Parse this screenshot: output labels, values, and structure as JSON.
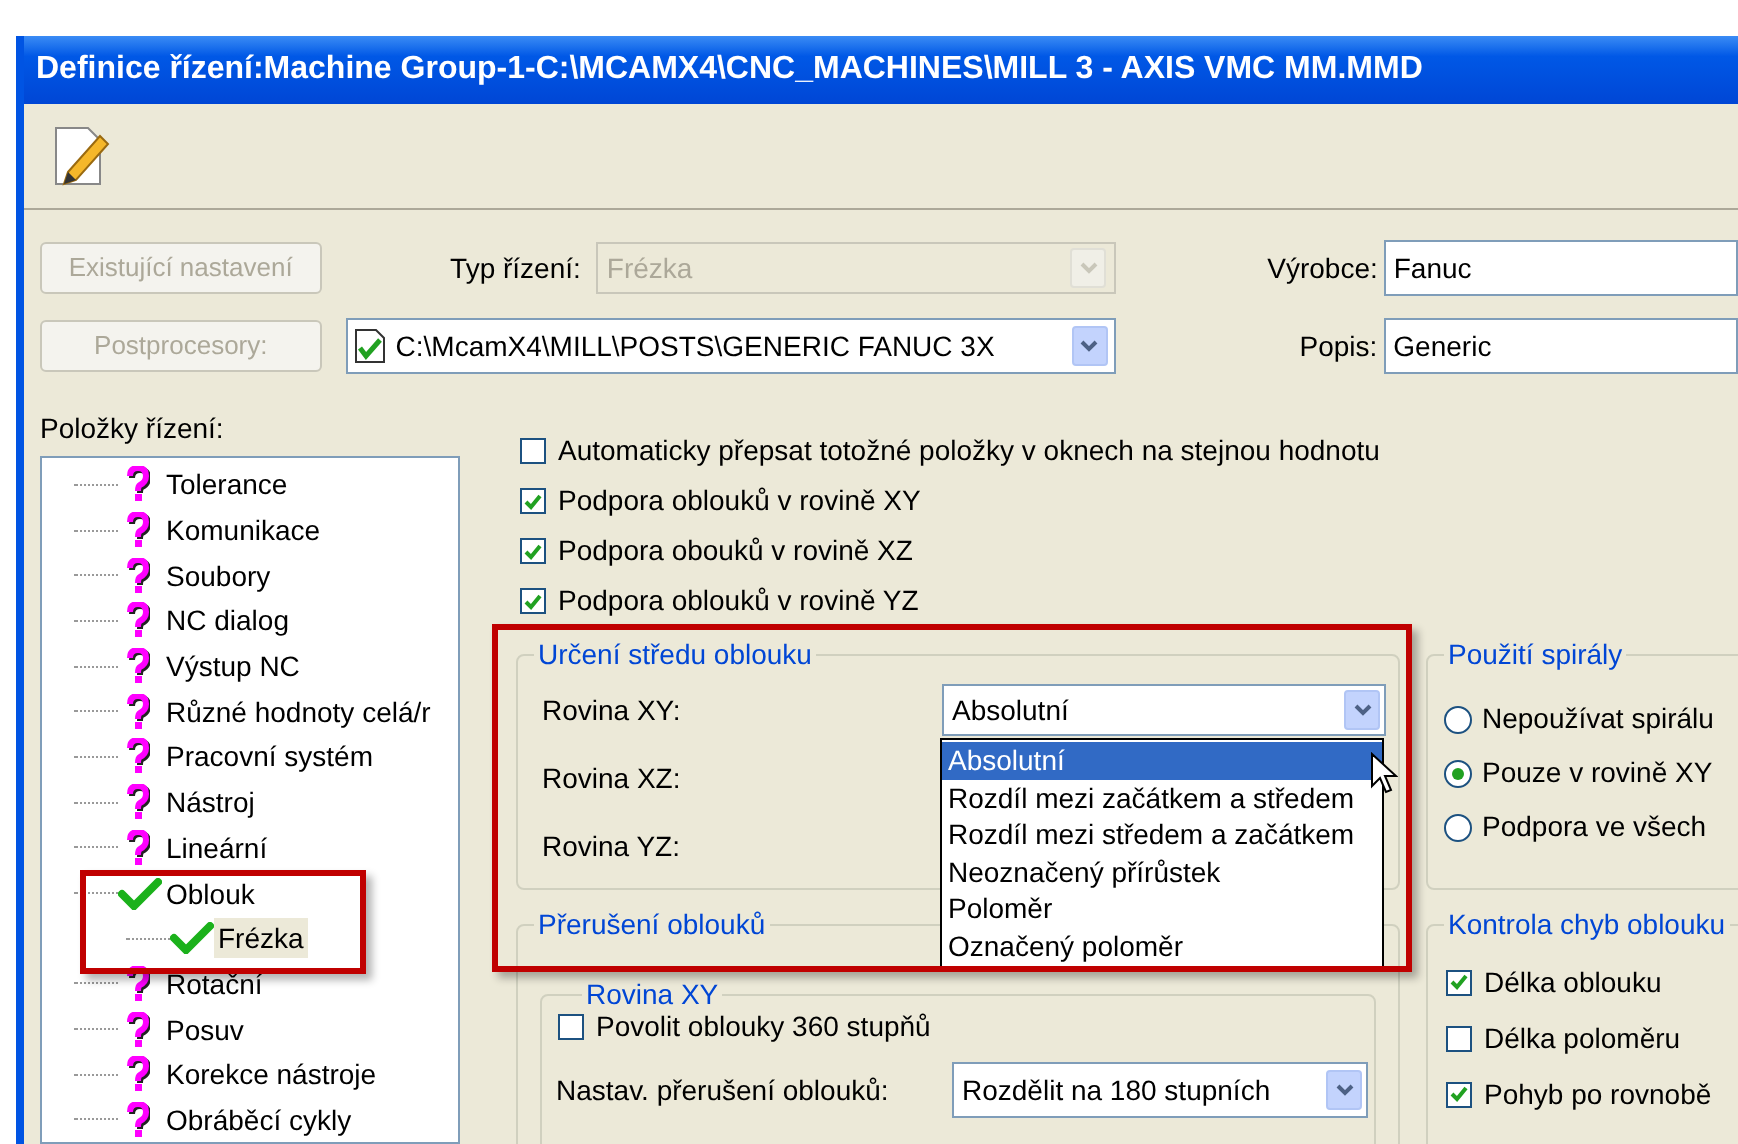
{
  "window": {
    "title": "Definice řízení:Machine Group-1-C:\\MCAMX4\\CNC_MACHINES\\MILL 3 - AXIS VMC MM.MMD"
  },
  "controls": {
    "existing_button": {
      "label": "Existující nastavení",
      "disabled": true
    },
    "control_type": {
      "label": "Typ řízení:",
      "value": "Frézka",
      "disabled": true
    },
    "post_button": {
      "label": "Postprocesory:",
      "disabled": true
    },
    "post_path": {
      "value": "C:\\McamX4\\MILL\\POSTS\\GENERIC FANUC 3X",
      "disabled": false
    },
    "manufacturer": {
      "label": "Výrobce:",
      "value": "Fanuc"
    },
    "description": {
      "label": "Popis:",
      "value": "Generic"
    }
  },
  "tree": {
    "label": "Položky řízení:",
    "items": [
      {
        "label": "Tolerance",
        "kind": "pending",
        "selected": false
      },
      {
        "label": "Komunikace",
        "kind": "pending",
        "selected": false
      },
      {
        "label": "Soubory",
        "kind": "pending",
        "selected": false
      },
      {
        "label": "NC dialog",
        "kind": "pending",
        "selected": false
      },
      {
        "label": "Výstup NC",
        "kind": "pending",
        "selected": false
      },
      {
        "label": "Různé hodnoty celá/r",
        "kind": "pending",
        "selected": false
      },
      {
        "label": "Pracovní systém",
        "kind": "pending",
        "selected": false
      },
      {
        "label": "Nástroj",
        "kind": "pending",
        "selected": false
      },
      {
        "label": "Lineární",
        "kind": "pending",
        "selected": false
      },
      {
        "label": "Oblouk",
        "kind": "done",
        "selected": false,
        "children": [
          {
            "label": "Frézka",
            "kind": "done",
            "selected": true
          }
        ]
      },
      {
        "label": "Rotační",
        "kind": "pending",
        "selected": false
      },
      {
        "label": "Posuv",
        "kind": "pending",
        "selected": false
      },
      {
        "label": "Korekce nástroje",
        "kind": "pending",
        "selected": false
      },
      {
        "label": "Obráběcí cykly",
        "kind": "pending",
        "selected": false
      }
    ]
  },
  "options": [
    {
      "label": "Automaticky přepsat totožné položky v oknech na stejnou hodnotu",
      "checked": false
    },
    {
      "label": "Podpora oblouků v rovině XY",
      "checked": true
    },
    {
      "label": "Podpora obouků v rovině XZ",
      "checked": true
    },
    {
      "label": "Podpora oblouků v rovině YZ",
      "checked": true
    }
  ],
  "arc_center": {
    "title": "Určení středu oblouku",
    "planes": [
      {
        "label": "Rovina XY:",
        "value": "Absolutní",
        "expanded": true
      },
      {
        "label": "Rovina XZ:"
      },
      {
        "label": "Rovina YZ:"
      }
    ],
    "dropdown_options": [
      {
        "label": "Absolutní",
        "selected": true
      },
      {
        "label": "Rozdíl mezi začátkem a středem",
        "selected": false
      },
      {
        "label": "Rozdíl mezi středem a začátkem",
        "selected": false
      },
      {
        "label": "Neoznačený přírůstek",
        "selected": false
      },
      {
        "label": "Poloměr",
        "selected": false
      },
      {
        "label": "Označený poloměr",
        "selected": false
      }
    ]
  },
  "arc_break": {
    "title": "Přerušení oblouků",
    "group": {
      "title": "Rovina XY",
      "allow_360": {
        "label": "Povolit oblouky 360 stupňů",
        "checked": false
      },
      "break_setting": {
        "label": "Nastav. přerušení oblouků:",
        "value": "Rozdělit na 180 stupních"
      }
    }
  },
  "helix": {
    "title": "Použití spirály",
    "options": [
      {
        "label": "Nepoužívat spirálu",
        "selected": false
      },
      {
        "label": "Pouze v rovině XY",
        "selected": true
      },
      {
        "label": "Podpora ve všech",
        "selected": false
      }
    ]
  },
  "arc_check": {
    "title": "Kontrola chyb oblouku",
    "options": [
      {
        "label": "Délka oblouku",
        "checked": true
      },
      {
        "label": "Délka poloměru",
        "checked": false
      },
      {
        "label": "Pohyb po rovnobě",
        "checked": true
      }
    ]
  }
}
